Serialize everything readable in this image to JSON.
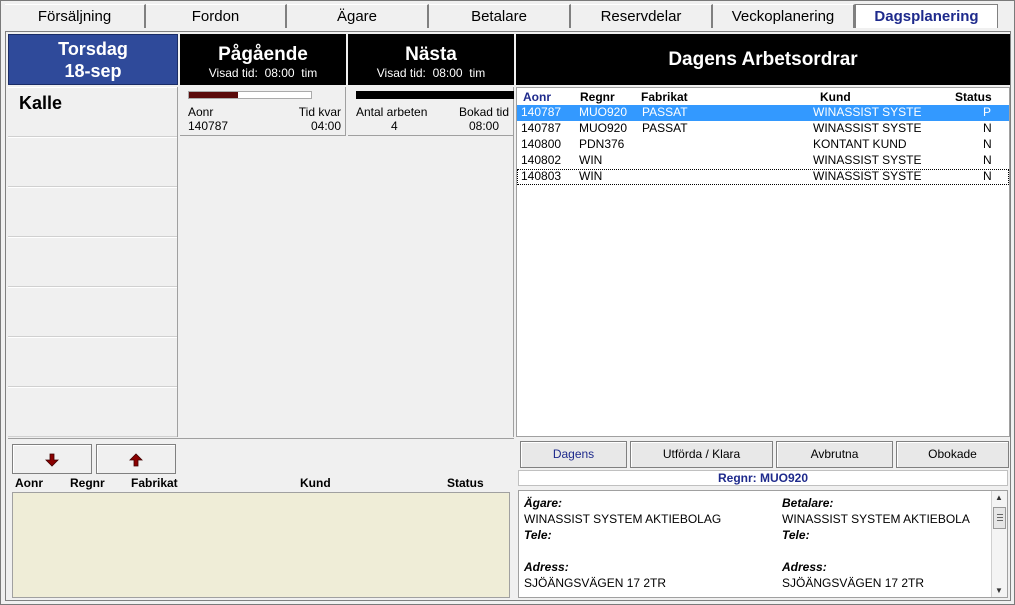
{
  "tabs": [
    {
      "label": "Försäljning"
    },
    {
      "label": "Fordon"
    },
    {
      "label": "Ägare"
    },
    {
      "label": "Betalare"
    },
    {
      "label": "Reservdelar"
    },
    {
      "label": "Veckoplanering"
    },
    {
      "label": "Dagsplanering"
    }
  ],
  "active_tab": "Dagsplanering",
  "day": {
    "weekday": "Torsdag",
    "date": "18-sep"
  },
  "pagaende": {
    "title": "Pågående",
    "visad_label": "Visad tid:",
    "visad_value": "08:00",
    "unit": "tim",
    "progress": 0.4,
    "aonr_label": "Aonr",
    "aonr_value": "140787",
    "tidkvar_label": "Tid kvar",
    "tidkvar_value": "04:00"
  },
  "nasta": {
    "title": "Nästa",
    "visad_label": "Visad tid:",
    "visad_value": "08:00",
    "unit": "tim",
    "antal_label": "Antal arbeten",
    "antal_value": "4",
    "bokad_label": "Bokad tid",
    "bokad_value": "08:00"
  },
  "mechanic": {
    "name": "Kalle"
  },
  "workorders": {
    "title": "Dagens Arbetsordrar",
    "columns": {
      "aonr": "Aonr",
      "regnr": "Regnr",
      "fabrikat": "Fabrikat",
      "kund": "Kund",
      "status": "Status"
    },
    "rows": [
      {
        "aonr": "140787",
        "regnr": "MUO920",
        "fabrikat": "PASSAT",
        "kund": "WINASSIST SYSTE",
        "status": "P"
      },
      {
        "aonr": "140787",
        "regnr": "MUO920",
        "fabrikat": "PASSAT",
        "kund": "WINASSIST SYSTE",
        "status": "N"
      },
      {
        "aonr": "140800",
        "regnr": "PDN376",
        "fabrikat": "",
        "kund": "KONTANT KUND",
        "status": "N"
      },
      {
        "aonr": "140802",
        "regnr": "WIN",
        "fabrikat": "",
        "kund": "WINASSIST SYSTE",
        "status": "N"
      },
      {
        "aonr": "140803",
        "regnr": "WIN",
        "fabrikat": "",
        "kund": "WINASSIST SYSTE",
        "status": "N"
      }
    ]
  },
  "lower_list": {
    "columns": {
      "aonr": "Aonr",
      "regnr": "Regnr",
      "fabrikat": "Fabrikat",
      "kund": "Kund",
      "status": "Status"
    }
  },
  "filters": {
    "dagens": "Dagens",
    "utforda": "Utförda / Klara",
    "avbrutna": "Avbrutna",
    "obokade": "Obokade"
  },
  "regnr_bar": "Regnr: MUO920",
  "details": {
    "agare_label": "Ägare:",
    "agare_value": "WINASSIST SYSTEM AKTIEBOLAG",
    "betalare_label": "Betalare:",
    "betalare_value": "WINASSIST SYSTEM AKTIEBOLA",
    "tele_label": "Tele:",
    "adress_label": "Adress:",
    "adress_value": "SJÖÄNGSVÄGEN 17 2TR"
  },
  "colors": {
    "accent": "#1e2a8c",
    "day_bg": "#2f4a9a",
    "selection": "#3399ff",
    "progress": "#5a0a0a",
    "lower_list_bg": "#efedd7"
  }
}
